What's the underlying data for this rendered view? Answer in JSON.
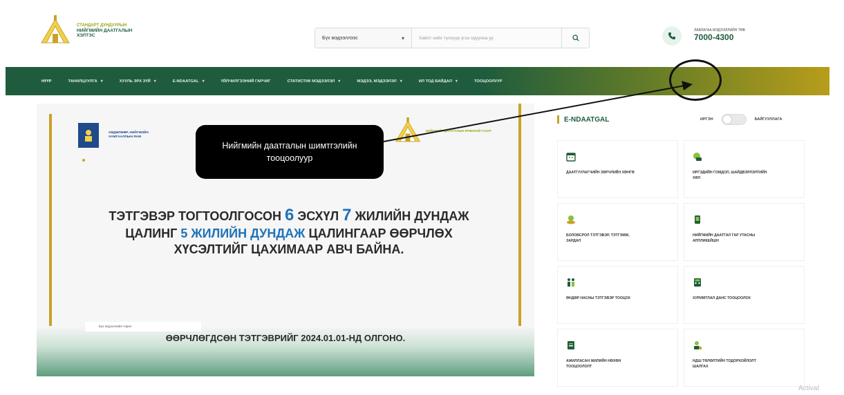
{
  "header": {
    "logo": {
      "line1": "СТАНДАРТ ДУНДУУРЫН",
      "line2": "НИЙГМИЙН ДААТГАЛЫН",
      "line3": "ХЭЛТЭС"
    },
    "search": {
      "category": "Бүх мэдээллээс",
      "placeholder": "Хайлт хийх түлхүүр үгээ оруулна уу",
      "icon": "search-icon"
    },
    "contact": {
      "label": "ЛАВЛАГАА МЭДЭЭЛЛИЙН ТӨВ",
      "phone": "7000-4300",
      "icon": "phone-icon"
    }
  },
  "nav": {
    "items": [
      {
        "label": "НҮҮР",
        "dropdown": false
      },
      {
        "label": "ТАНИЛЦУУЛГА",
        "dropdown": true
      },
      {
        "label": "ХУУЛЬ ЭРХ ЗҮЙ",
        "dropdown": true
      },
      {
        "label": "E-NDAATGAL",
        "dropdown": true
      },
      {
        "label": "ҮЙЛЧИЛГЭЭНИЙ ГАРЧИГ",
        "dropdown": false
      },
      {
        "label": "СТАТИСТИК МЭДЭЭЛЭЛ",
        "dropdown": true
      },
      {
        "label": "МЭДЭЭ, МЭДЭЭЛЭЛ",
        "dropdown": true
      },
      {
        "label": "ИЛ ТОД БАЙДАЛ",
        "dropdown": true
      },
      {
        "label": "ТООЦООЛУУР",
        "dropdown": false
      }
    ]
  },
  "banner": {
    "ministry": "ХӨДӨЛМӨР, НИЙГМИЙН ХАМГААЛЛЫН ЯАМ",
    "logo_text": "НИЙГМИЙН ДААТГАЛЫН ЕРӨНХИЙ ГАЗАР",
    "headline_a": "ТЭТГЭВЭР ТОГТООЛГОСОН ",
    "headline_n1": "6",
    "headline_b": " ЭСХҮЛ ",
    "headline_n2": "7",
    "headline_c": " ЖИЛИЙН ДУНДАЖ ЦАЛИНГ ",
    "headline_n3": "5 ЖИЛИЙН ДУНДАЖ",
    "headline_d": " ЦАЛИНГААР ӨӨРЧЛӨХ ХҮСЭЛТИЙГ ЦАХИМААР АВЧ БАЙНА.",
    "small_label": "Бүх мэдээллийн төрөл",
    "bottom_text": "ӨӨРЧЛӨГДСӨН ТЭТГЭВРИЙГ 2024.01.01-НД ОЛГОНО."
  },
  "callout": {
    "text": "Нийгмийн даатгалын шимтгэлийн тооцоолуур"
  },
  "panel": {
    "title": "E-NDAATGAL",
    "toggle_left": "ИРГЭН",
    "toggle_right": "БАЙГУУЛЛАГА",
    "cards": [
      {
        "label": "ДААТГУУЛАГЧИЙН ЗӨРЧЛИЙН ХӨНГӨ",
        "icon": "calendar-icon"
      },
      {
        "label": "ИРГЭДИЙН ГОМДОЛ, ШАЙДВЭРЛЭЛТИЙН ХӨЛ",
        "icon": "chat-icon"
      },
      {
        "label": "БОЛОВСРОЛ ТЭТГЭВЭР, ТЭТГЭМЖ, ЗАРДАЛ",
        "icon": "coins-icon"
      },
      {
        "label": "НИЙГМИЙН ДААТГАЛ ГАР УТАСНЫ АППЛИКЕЙШН",
        "icon": "mobile-icon"
      },
      {
        "label": "ӨНДӨР НАСНЫ ТЭТГЭВЭР ТООЦОХ",
        "icon": "people-icon"
      },
      {
        "label": "ХУРИМТЛАЛ ДАНС ТООЦООЛОХ",
        "icon": "calculator-icon"
      },
      {
        "label": "АЖИЛЛАСАН ЖИЛИЙН НӨХӨН ТООЦООЛОЛТ",
        "icon": "document-icon"
      },
      {
        "label": "НДШ ТӨЛӨЛТИЙН ТОДОРХОЙЛОЛТ ШАЛГАХ",
        "icon": "person-check-icon"
      }
    ]
  },
  "watermark": "Activat",
  "colors": {
    "primary_green": "#1e5c3d",
    "gold": "#c9a227",
    "accent_blue": "#1f73b8"
  }
}
